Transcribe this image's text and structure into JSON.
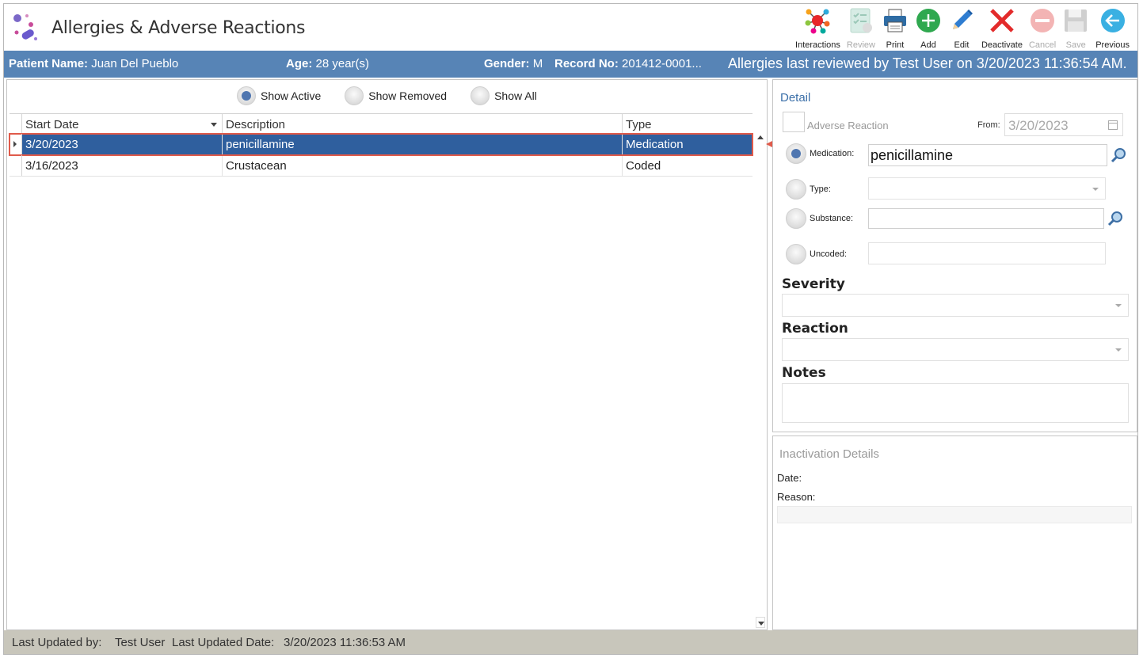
{
  "app": {
    "title": "Allergies & Adverse Reactions"
  },
  "toolbar": [
    {
      "label": "Interactions",
      "icon": "interactions-icon",
      "enabled": true
    },
    {
      "label": "Review",
      "icon": "review-icon",
      "enabled": false
    },
    {
      "label": "Print",
      "icon": "printer-icon",
      "enabled": true
    },
    {
      "label": "Add",
      "icon": "add-icon",
      "enabled": true
    },
    {
      "label": "Edit",
      "icon": "pencil-icon",
      "enabled": true
    },
    {
      "label": "Deactivate",
      "icon": "x-icon",
      "enabled": true
    },
    {
      "label": "Cancel",
      "icon": "cancel-icon",
      "enabled": false
    },
    {
      "label": "Save",
      "icon": "floppy-icon",
      "enabled": false
    },
    {
      "label": "Previous",
      "icon": "back-arrow-icon",
      "enabled": true
    }
  ],
  "patient": {
    "name_label": "Patient Name:",
    "name": "Juan Del Pueblo",
    "age_label": "Age:",
    "age": "28 year(s)",
    "gender_label": "Gender:",
    "gender": "M",
    "record_label": "Record No:",
    "record": "201412-0001...",
    "reviewed": "Allergies last reviewed by Test User on 3/20/2023 11:36:54 AM."
  },
  "filters": {
    "show_active": "Show Active",
    "show_removed": "Show Removed",
    "show_all": "Show All",
    "selected": "show_active"
  },
  "grid": {
    "columns": [
      "Start Date",
      "Description",
      "Type"
    ],
    "rows": [
      {
        "start_date": "3/20/2023",
        "description": "penicillamine",
        "type": "Medication",
        "selected": true
      },
      {
        "start_date": "3/16/2023",
        "description": "Crustacean",
        "type": "Coded",
        "selected": false
      }
    ]
  },
  "detail": {
    "title": "Detail",
    "adverse_reaction_label": "Adverse Reaction",
    "from_label": "From:",
    "from_value": "3/20/2023",
    "medication_label": "Medication:",
    "medication_value": "penicillamine",
    "type_label": "Type:",
    "substance_label": "Substance:",
    "uncoded_label": "Uncoded:",
    "severity_label": "Severity",
    "reaction_label": "Reaction",
    "notes_label": "Notes"
  },
  "inactivation": {
    "title": "Inactivation Details",
    "date_label": "Date:",
    "reason_label": "Reason:"
  },
  "status": {
    "updated_by_label": "Last Updated by:",
    "updated_by": "Test User",
    "updated_date_label": "Last Updated Date:",
    "updated_date": "3/20/2023 11:36:53 AM"
  },
  "colors": {
    "accent": "#5784b6",
    "selection": "#2f5f9e",
    "callout": "#e05a4a",
    "statusbar": "#c8c6bb"
  }
}
